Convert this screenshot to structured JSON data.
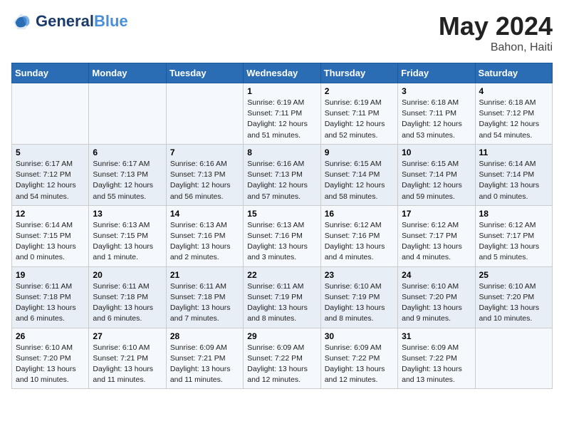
{
  "header": {
    "logo_general": "General",
    "logo_blue": "Blue",
    "month_year": "May 2024",
    "location": "Bahon, Haiti"
  },
  "columns": [
    "Sunday",
    "Monday",
    "Tuesday",
    "Wednesday",
    "Thursday",
    "Friday",
    "Saturday"
  ],
  "weeks": [
    [
      {
        "day": "",
        "sunrise": "",
        "sunset": "",
        "daylight": ""
      },
      {
        "day": "",
        "sunrise": "",
        "sunset": "",
        "daylight": ""
      },
      {
        "day": "",
        "sunrise": "",
        "sunset": "",
        "daylight": ""
      },
      {
        "day": "1",
        "sunrise": "Sunrise: 6:19 AM",
        "sunset": "Sunset: 7:11 PM",
        "daylight": "Daylight: 12 hours and 51 minutes."
      },
      {
        "day": "2",
        "sunrise": "Sunrise: 6:19 AM",
        "sunset": "Sunset: 7:11 PM",
        "daylight": "Daylight: 12 hours and 52 minutes."
      },
      {
        "day": "3",
        "sunrise": "Sunrise: 6:18 AM",
        "sunset": "Sunset: 7:11 PM",
        "daylight": "Daylight: 12 hours and 53 minutes."
      },
      {
        "day": "4",
        "sunrise": "Sunrise: 6:18 AM",
        "sunset": "Sunset: 7:12 PM",
        "daylight": "Daylight: 12 hours and 54 minutes."
      }
    ],
    [
      {
        "day": "5",
        "sunrise": "Sunrise: 6:17 AM",
        "sunset": "Sunset: 7:12 PM",
        "daylight": "Daylight: 12 hours and 54 minutes."
      },
      {
        "day": "6",
        "sunrise": "Sunrise: 6:17 AM",
        "sunset": "Sunset: 7:13 PM",
        "daylight": "Daylight: 12 hours and 55 minutes."
      },
      {
        "day": "7",
        "sunrise": "Sunrise: 6:16 AM",
        "sunset": "Sunset: 7:13 PM",
        "daylight": "Daylight: 12 hours and 56 minutes."
      },
      {
        "day": "8",
        "sunrise": "Sunrise: 6:16 AM",
        "sunset": "Sunset: 7:13 PM",
        "daylight": "Daylight: 12 hours and 57 minutes."
      },
      {
        "day": "9",
        "sunrise": "Sunrise: 6:15 AM",
        "sunset": "Sunset: 7:14 PM",
        "daylight": "Daylight: 12 hours and 58 minutes."
      },
      {
        "day": "10",
        "sunrise": "Sunrise: 6:15 AM",
        "sunset": "Sunset: 7:14 PM",
        "daylight": "Daylight: 12 hours and 59 minutes."
      },
      {
        "day": "11",
        "sunrise": "Sunrise: 6:14 AM",
        "sunset": "Sunset: 7:14 PM",
        "daylight": "Daylight: 13 hours and 0 minutes."
      }
    ],
    [
      {
        "day": "12",
        "sunrise": "Sunrise: 6:14 AM",
        "sunset": "Sunset: 7:15 PM",
        "daylight": "Daylight: 13 hours and 0 minutes."
      },
      {
        "day": "13",
        "sunrise": "Sunrise: 6:13 AM",
        "sunset": "Sunset: 7:15 PM",
        "daylight": "Daylight: 13 hours and 1 minute."
      },
      {
        "day": "14",
        "sunrise": "Sunrise: 6:13 AM",
        "sunset": "Sunset: 7:16 PM",
        "daylight": "Daylight: 13 hours and 2 minutes."
      },
      {
        "day": "15",
        "sunrise": "Sunrise: 6:13 AM",
        "sunset": "Sunset: 7:16 PM",
        "daylight": "Daylight: 13 hours and 3 minutes."
      },
      {
        "day": "16",
        "sunrise": "Sunrise: 6:12 AM",
        "sunset": "Sunset: 7:16 PM",
        "daylight": "Daylight: 13 hours and 4 minutes."
      },
      {
        "day": "17",
        "sunrise": "Sunrise: 6:12 AM",
        "sunset": "Sunset: 7:17 PM",
        "daylight": "Daylight: 13 hours and 4 minutes."
      },
      {
        "day": "18",
        "sunrise": "Sunrise: 6:12 AM",
        "sunset": "Sunset: 7:17 PM",
        "daylight": "Daylight: 13 hours and 5 minutes."
      }
    ],
    [
      {
        "day": "19",
        "sunrise": "Sunrise: 6:11 AM",
        "sunset": "Sunset: 7:18 PM",
        "daylight": "Daylight: 13 hours and 6 minutes."
      },
      {
        "day": "20",
        "sunrise": "Sunrise: 6:11 AM",
        "sunset": "Sunset: 7:18 PM",
        "daylight": "Daylight: 13 hours and 6 minutes."
      },
      {
        "day": "21",
        "sunrise": "Sunrise: 6:11 AM",
        "sunset": "Sunset: 7:18 PM",
        "daylight": "Daylight: 13 hours and 7 minutes."
      },
      {
        "day": "22",
        "sunrise": "Sunrise: 6:11 AM",
        "sunset": "Sunset: 7:19 PM",
        "daylight": "Daylight: 13 hours and 8 minutes."
      },
      {
        "day": "23",
        "sunrise": "Sunrise: 6:10 AM",
        "sunset": "Sunset: 7:19 PM",
        "daylight": "Daylight: 13 hours and 8 minutes."
      },
      {
        "day": "24",
        "sunrise": "Sunrise: 6:10 AM",
        "sunset": "Sunset: 7:20 PM",
        "daylight": "Daylight: 13 hours and 9 minutes."
      },
      {
        "day": "25",
        "sunrise": "Sunrise: 6:10 AM",
        "sunset": "Sunset: 7:20 PM",
        "daylight": "Daylight: 13 hours and 10 minutes."
      }
    ],
    [
      {
        "day": "26",
        "sunrise": "Sunrise: 6:10 AM",
        "sunset": "Sunset: 7:20 PM",
        "daylight": "Daylight: 13 hours and 10 minutes."
      },
      {
        "day": "27",
        "sunrise": "Sunrise: 6:10 AM",
        "sunset": "Sunset: 7:21 PM",
        "daylight": "Daylight: 13 hours and 11 minutes."
      },
      {
        "day": "28",
        "sunrise": "Sunrise: 6:09 AM",
        "sunset": "Sunset: 7:21 PM",
        "daylight": "Daylight: 13 hours and 11 minutes."
      },
      {
        "day": "29",
        "sunrise": "Sunrise: 6:09 AM",
        "sunset": "Sunset: 7:22 PM",
        "daylight": "Daylight: 13 hours and 12 minutes."
      },
      {
        "day": "30",
        "sunrise": "Sunrise: 6:09 AM",
        "sunset": "Sunset: 7:22 PM",
        "daylight": "Daylight: 13 hours and 12 minutes."
      },
      {
        "day": "31",
        "sunrise": "Sunrise: 6:09 AM",
        "sunset": "Sunset: 7:22 PM",
        "daylight": "Daylight: 13 hours and 13 minutes."
      },
      {
        "day": "",
        "sunrise": "",
        "sunset": "",
        "daylight": ""
      }
    ]
  ]
}
